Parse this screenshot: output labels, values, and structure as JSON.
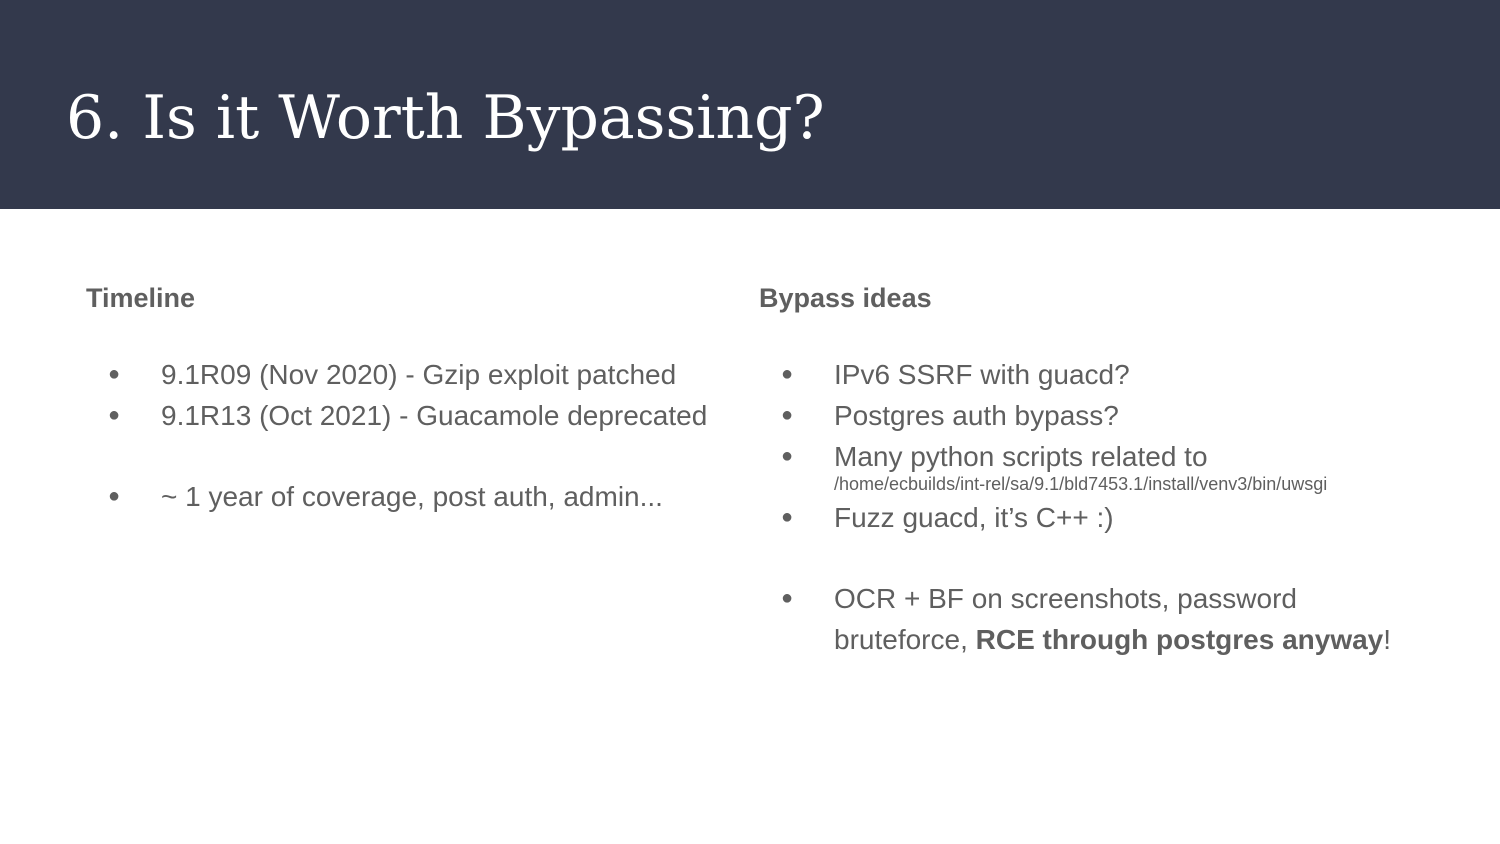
{
  "title": "6. Is it Worth Bypassing?",
  "colors": {
    "title_bar": "#33394c",
    "title_text": "#ffffff",
    "body_text": "#5f5f5f"
  },
  "bullet_glyph": "●",
  "timeline": {
    "heading": "Timeline",
    "items": [
      "9.1R09 (Nov 2020) - Gzip exploit patched",
      "9.1R13 (Oct  2021) - Guacamole deprecated",
      "~ 1 year of coverage, post auth, admin..."
    ]
  },
  "bypass": {
    "heading": "Bypass ideas",
    "item1": "IPv6 SSRF with guacd?",
    "item2": "Postgres auth bypass?",
    "item3": "Many python scripts related to",
    "item3_path": "/home/ecbuilds/int-rel/sa/9.1/bld7453.1/install/venv3/bin/uwsgi",
    "item4": "Fuzz guacd, it’s C++ :)",
    "item5_line1": "OCR + BF on screenshots, password",
    "item5_line2_prefix": "bruteforce, ",
    "item5_line2_bold": "RCE through postgres anyway",
    "item5_line2_suffix": "!"
  }
}
